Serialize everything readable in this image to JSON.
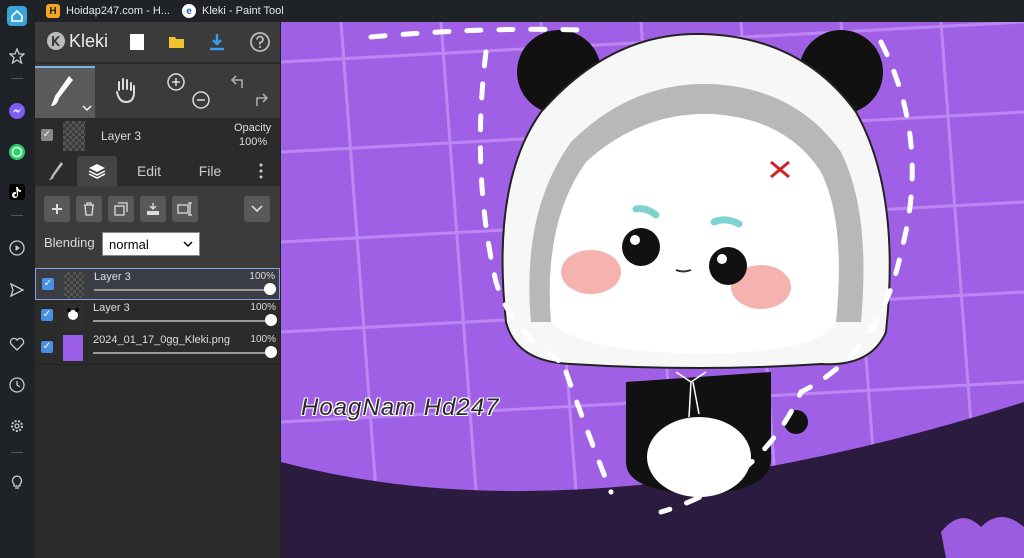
{
  "browser": {
    "tabs": [
      {
        "title": "Hoidap247.com - H...",
        "icon": "hoidap-favicon"
      },
      {
        "title": "Kleki - Paint Tool",
        "icon": "kleki-favicon"
      }
    ]
  },
  "sidebar": {
    "icons": [
      "home-icon",
      "star-icon",
      "messenger-icon",
      "whatsapp-icon",
      "tiktok-icon",
      "play-icon",
      "send-icon",
      "heart-icon",
      "history-icon",
      "settings-icon",
      "lightbulb-icon"
    ]
  },
  "app": {
    "logo": "Kleki",
    "layer_preview": {
      "name": "Layer 3",
      "opacity_label": "Opacity",
      "opacity_value": "100%"
    },
    "tabs": {
      "edit": "Edit",
      "file": "File"
    },
    "blending": {
      "label": "Blending",
      "value": "normal"
    },
    "layers": [
      {
        "name": "Layer 3",
        "opacity": "100%",
        "active": true
      },
      {
        "name": "Layer 3",
        "opacity": "100%",
        "active": false
      },
      {
        "name": "2024_01_17_0gg_Kleki.png",
        "opacity": "100%",
        "active": false
      }
    ]
  },
  "canvas": {
    "watermark": "HoagNam Hd247",
    "colors": {
      "background": "#a060e6",
      "grid": "#c18cf5",
      "shadow": "#2a1b3f"
    }
  }
}
